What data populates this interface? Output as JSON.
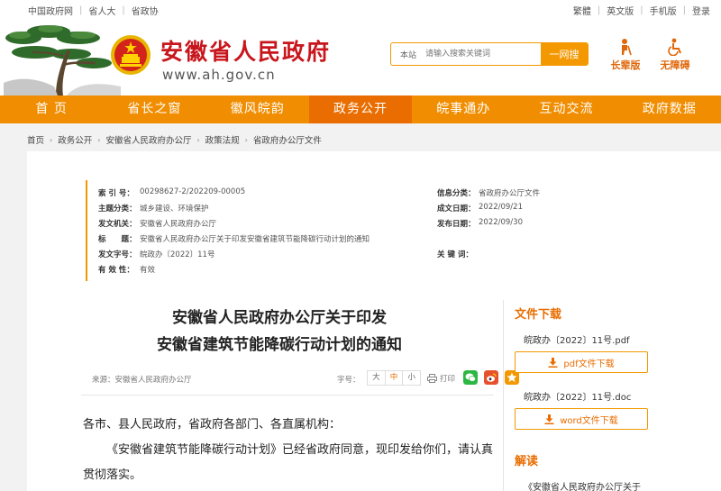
{
  "topbar": {
    "links_left": [
      "中国政府网",
      "省人大",
      "省政协"
    ],
    "links_right": [
      "繁體",
      "英文版",
      "手机版",
      "登录"
    ]
  },
  "header": {
    "site_title": "安徽省人民政府",
    "site_url": "www.ah.gov.cn",
    "search_scope": "本站",
    "search_placeholder": "请输入搜索关键词",
    "search_button": "一网搜",
    "elder_mode": "长辈版",
    "accessibility": "无障碍"
  },
  "nav": {
    "items": [
      "首 页",
      "省长之窗",
      "徽风皖韵",
      "政务公开",
      "皖事通办",
      "互动交流",
      "政府数据"
    ],
    "active_index": 3
  },
  "breadcrumb": [
    "首页",
    "政务公开",
    "安徽省人民政府办公厅",
    "政策法规",
    "省政府办公厅文件"
  ],
  "meta": {
    "index_label": "索 引 号：",
    "index_value": "00298627-2/202209-00005",
    "category_label": "信息分类：",
    "category_value": "省政府办公厅文件",
    "topic_label": "主题分类：",
    "topic_value": "城乡建设、环境保护",
    "date_made_label": "成文日期：",
    "date_made_value": "2022/09/21",
    "issuer_label": "发文机关：",
    "issuer_value": "安徽省人民政府办公厅",
    "date_pub_label": "发布日期：",
    "date_pub_value": "2022/09/30",
    "title_label": "标　　题：",
    "title_value": "安徽省人民政府办公厅关于印发安徽省建筑节能降碳行动计划的通知",
    "docno_label": "发文字号：",
    "docno_value": "皖政办〔2022〕11号",
    "keywords_label": "关 键 词：",
    "keywords_value": "",
    "validity_label": "有 效 性：",
    "validity_value": "有效"
  },
  "article": {
    "title_line1": "安徽省人民政府办公厅关于印发",
    "title_line2": "安徽省建筑节能降碳行动计划的通知",
    "source": "来源：安徽省人民政府办公厅",
    "font_size_label": "字号：",
    "font_sizes": [
      "大",
      "中",
      "小"
    ],
    "font_size_active": 1,
    "print_label": "打印",
    "salutation": "各市、县人民政府，省政府各部门、各直属机构：",
    "body_line": "《安徽省建筑节能降碳行动计划》已经省政府同意，现印发给你们，请认真贯彻落实。"
  },
  "side": {
    "download_heading": "文件下载",
    "file1_name": "皖政办〔2022〕11号.pdf",
    "file1_button": "pdf文件下载",
    "file2_name": "皖政办〔2022〕11号.doc",
    "file2_button": "word文件下载",
    "read_heading": "解读",
    "read_item": "《安徽省人民政府办公厅关于"
  },
  "colors": {
    "brand_red": "#c8161d",
    "nav_orange": "#f18d00",
    "nav_active": "#e96d00",
    "accent": "#f39800"
  }
}
